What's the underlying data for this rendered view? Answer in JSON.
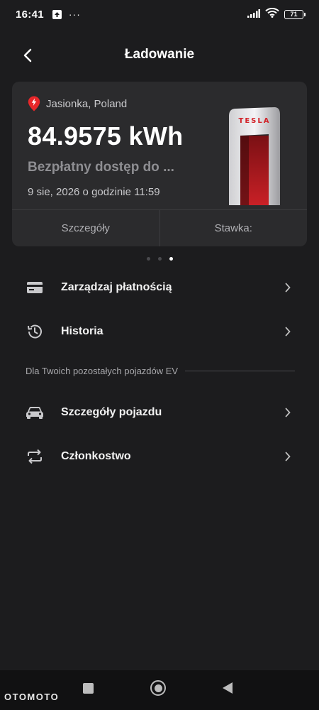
{
  "status_bar": {
    "time": "16:41",
    "more": "···",
    "battery_level": "71"
  },
  "header": {
    "title": "Ładowanie"
  },
  "card": {
    "location": "Jasionka, Poland",
    "energy": "84.9575 kWh",
    "access": "Bezpłatny dostęp do ...",
    "date": "9 sie, 2026 o godzinie 11:59",
    "charger_brand": "TESLA",
    "details_button": "Szczegóły",
    "rate_button": "Stawka:"
  },
  "pager": {
    "total": 3,
    "active_index": 2
  },
  "menu": {
    "payment": "Zarządzaj płatnością",
    "history": "Historia",
    "section": "Dla Twoich pozostałych pojazdów EV",
    "vehicle": "Szczegóły pojazdu",
    "membership": "Członkostwo"
  },
  "watermark": "OTOMOTO",
  "colors": {
    "background": "#1c1c1e",
    "card": "#2b2b2d",
    "accent_red": "#e8272a"
  }
}
